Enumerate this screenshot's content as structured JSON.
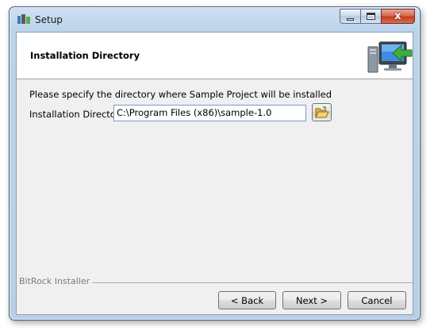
{
  "window": {
    "title": "Setup",
    "close_glyph": "x"
  },
  "header": {
    "title": "Installation Directory",
    "icon": "computer-install-icon"
  },
  "body": {
    "instruction": "Please specify the directory where Sample Project will be installed",
    "directory_label": "Installation Directory",
    "directory_value": "C:\\Program Files (x86)\\sample-1.0",
    "browse_icon": "folder-open-icon"
  },
  "footer": {
    "brand": "BitRock Installer",
    "back_label": "< Back",
    "next_label": "Next >",
    "cancel_label": "Cancel"
  }
}
